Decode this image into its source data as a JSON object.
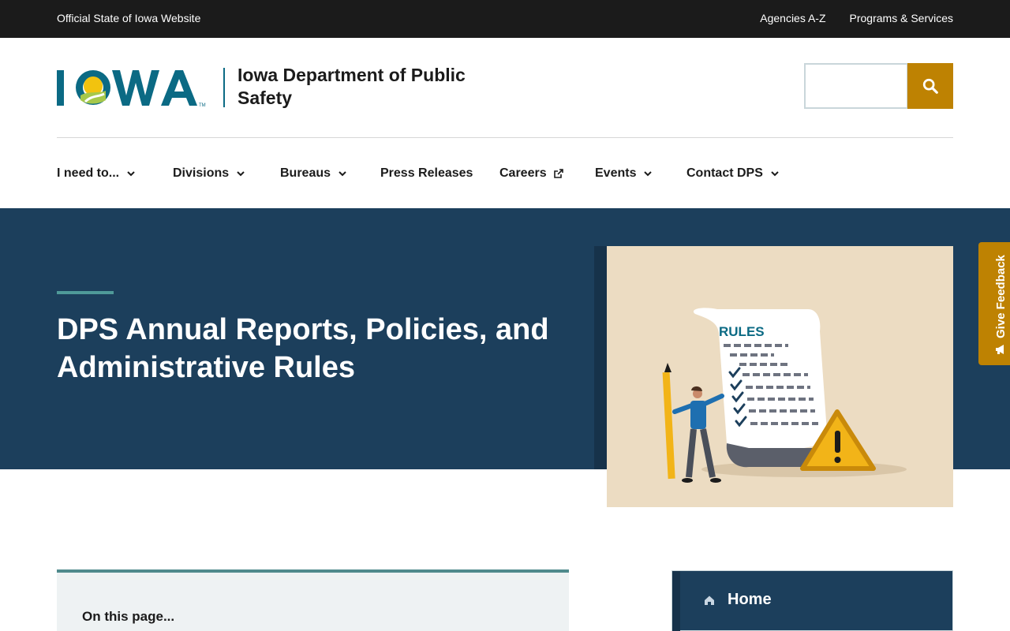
{
  "topbar": {
    "official": "Official State of Iowa Website",
    "links": [
      "Agencies A-Z",
      "Programs & Services"
    ]
  },
  "header": {
    "logo_text": "IOWA",
    "agency_name": "Iowa Department of Public Safety",
    "search": {
      "placeholder": "",
      "icon": "search-icon"
    }
  },
  "nav": {
    "items": [
      {
        "label": "I need to...",
        "icon": "chevron-down-icon"
      },
      {
        "label": "Divisions",
        "icon": "chevron-down-icon"
      },
      {
        "label": "Bureaus",
        "icon": "chevron-down-icon"
      },
      {
        "label": "Press Releases"
      },
      {
        "label": "Careers",
        "icon": "external-link-icon"
      },
      {
        "label": "Events",
        "icon": "chevron-down-icon"
      },
      {
        "label": "Contact DPS",
        "icon": "chevron-down-icon"
      }
    ]
  },
  "hero": {
    "title": "DPS Annual Reports, Policies, and Administrative Rules",
    "image": {
      "document_heading": "RULES"
    }
  },
  "feedback": {
    "label": "Give Feedback",
    "icon": "megaphone-icon"
  },
  "on_this_page": {
    "title": "On this page..."
  },
  "sidenav": {
    "home_label": "Home",
    "icon": "home-icon"
  },
  "colors": {
    "topbar": "#1b1b1b",
    "hero": "#1c3f5c",
    "accent_gold": "#be8202",
    "teal": "#0b6a84",
    "hero_image_bg": "#ecdcc2"
  }
}
